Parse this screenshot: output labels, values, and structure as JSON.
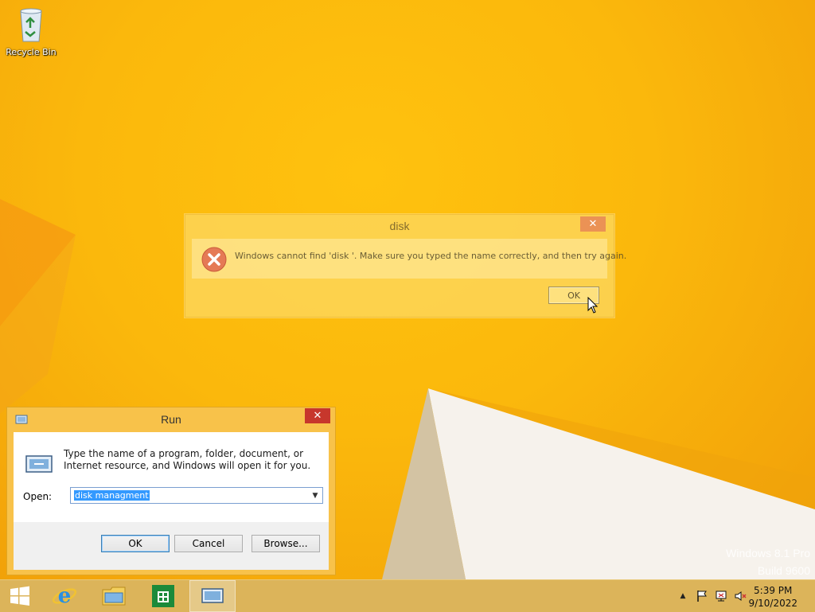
{
  "desktop": {
    "icons": [
      {
        "label": "Recycle Bin",
        "icon": "recycle-bin-icon"
      }
    ],
    "watermark": {
      "line1": "Windows 8.1 Pro",
      "line2": "Build 9600"
    }
  },
  "error_dialog": {
    "title": "disk",
    "message": "Windows cannot find 'disk '. Make sure you typed the name correctly, and then try again.",
    "ok_label": "OK",
    "close_glyph": "✕",
    "icon": "error-icon"
  },
  "run_dialog": {
    "title": "Run",
    "close_glyph": "✕",
    "description": "Type the name of a program, folder, document, or Internet resource, and Windows will open it for you.",
    "open_label": "Open:",
    "input_value": "disk managment",
    "buttons": {
      "ok": "OK",
      "cancel": "Cancel",
      "browse": "Browse..."
    }
  },
  "taskbar": {
    "items": [
      "start-button",
      "internet-explorer",
      "file-explorer",
      "store",
      "run"
    ],
    "clock": {
      "time": "5:39 PM",
      "date": "9/10/2022"
    },
    "tray": [
      "show-hidden-icons",
      "action-center-flag",
      "network",
      "volume-muted"
    ]
  },
  "colors": {
    "wallpaper": "#fbb80c",
    "taskbar": "#dcb45a",
    "run_frame": "#f8c24a",
    "close_red": "#c7372c",
    "selection": "#3399ff"
  }
}
